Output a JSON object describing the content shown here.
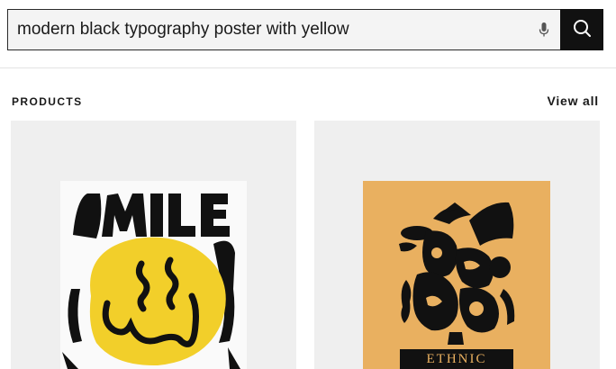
{
  "search": {
    "query": "modern black typography poster with yellow"
  },
  "products_section": {
    "title": "PRODUCTS",
    "view_all_label": "View all"
  },
  "products": [
    {
      "poster_text": "SMILE",
      "poster_colors": {
        "background": "#fafafa",
        "ink": "#111111",
        "face": "#f2cf2a"
      }
    },
    {
      "poster_text": "ETHNIC",
      "poster_colors": {
        "background": "#e9b060",
        "ink": "#111111"
      }
    }
  ],
  "colors": {
    "search_button": "#111111",
    "card_background": "#efefef"
  },
  "icons": [
    "microphone-icon",
    "search-icon"
  ]
}
